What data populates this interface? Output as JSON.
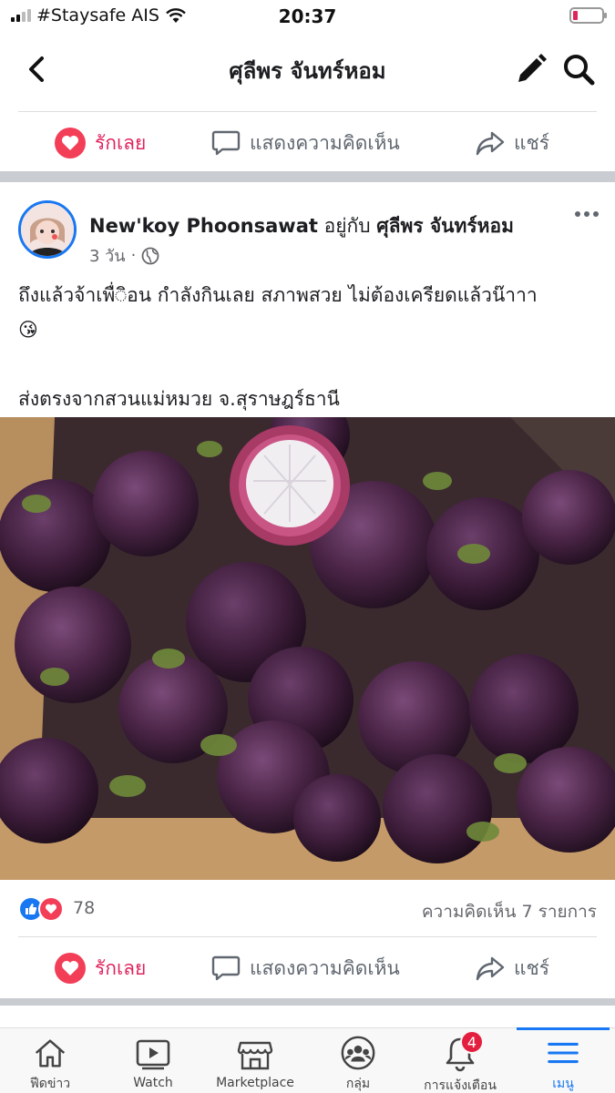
{
  "status_bar": {
    "carrier": "#Staysafe AIS",
    "time": "20:37"
  },
  "header": {
    "title": "ศุลีพร จันทร์หอม",
    "icons": [
      "back-icon",
      "edit-icon",
      "search-icon"
    ]
  },
  "actions": {
    "love_label": "รักเลย",
    "comment_label": "แสดงความคิดเห็น",
    "share_label": "แชร์"
  },
  "post": {
    "author": "New'koy Phoonsawat",
    "with_text": "อยู่กับ",
    "tagged": "ศุลีพร จันทร์หอม",
    "time": "3 วัน",
    "text_line1": "ถึงแล้วจ้าเพื่◌ิอน กำลังกินเลย สภาพสวย ไม่ต้องเครียดแล้วน๊าาา",
    "text_emoji": "😘",
    "text_line2": "ส่งตรงจากสวนแม่หมวย จ.สุราษฎร์ธานี",
    "reaction_count": "78",
    "comment_count_label": "ความคิดเห็น 7 รายการ"
  },
  "tab_bar": {
    "items": [
      {
        "label": "ฟีดข่าว",
        "icon": "home-icon"
      },
      {
        "label": "Watch",
        "icon": "watch-icon"
      },
      {
        "label": "Marketplace",
        "icon": "marketplace-icon"
      },
      {
        "label": "กลุ่ม",
        "icon": "groups-icon"
      },
      {
        "label": "การแจ้งเตือน",
        "icon": "bell-icon",
        "badge": "4"
      },
      {
        "label": "เมนู",
        "icon": "menu-icon"
      }
    ]
  },
  "colors": {
    "accent": "#1877f2",
    "love": "#e0245e",
    "muted": "#606770"
  }
}
